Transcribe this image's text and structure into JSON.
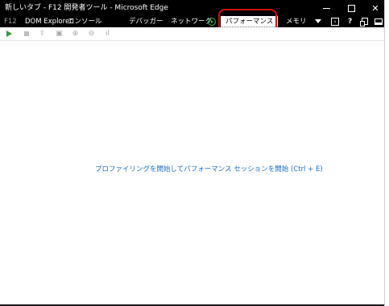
{
  "window": {
    "title": "新しいタブ - F12 開発者ツール - Microsoft Edge",
    "controls": {
      "minimize": "",
      "maximize": "",
      "close": "✕"
    }
  },
  "tabs": {
    "f12": "F12",
    "items": [
      {
        "label": "DOM Explorer"
      },
      {
        "label": "コンソール"
      },
      {
        "label": "デバッガー"
      },
      {
        "label": "ネットワーク"
      },
      {
        "label": "パフォーマンス",
        "active": true
      },
      {
        "label": "メモリ"
      }
    ],
    "console_glyph": "›"
  },
  "help": "?",
  "toolbar": {
    "icons": [
      "play-icon",
      "stop-icon",
      "import-icon",
      "save-icon",
      "zoom-in-icon",
      "zoom-out-icon",
      "chart-icon"
    ],
    "glyphs": {
      "import": "⇪",
      "save": "▣",
      "zoom_in": "⊕",
      "zoom_out": "⊖",
      "chart": "ıl"
    }
  },
  "main": {
    "message": "プロファイリングを開始してパフォーマンス セッションを開始 (Ctrl + E)"
  },
  "colors": {
    "annotation": "#d01010",
    "link": "#1c6fc6",
    "record": "#3fb950"
  }
}
